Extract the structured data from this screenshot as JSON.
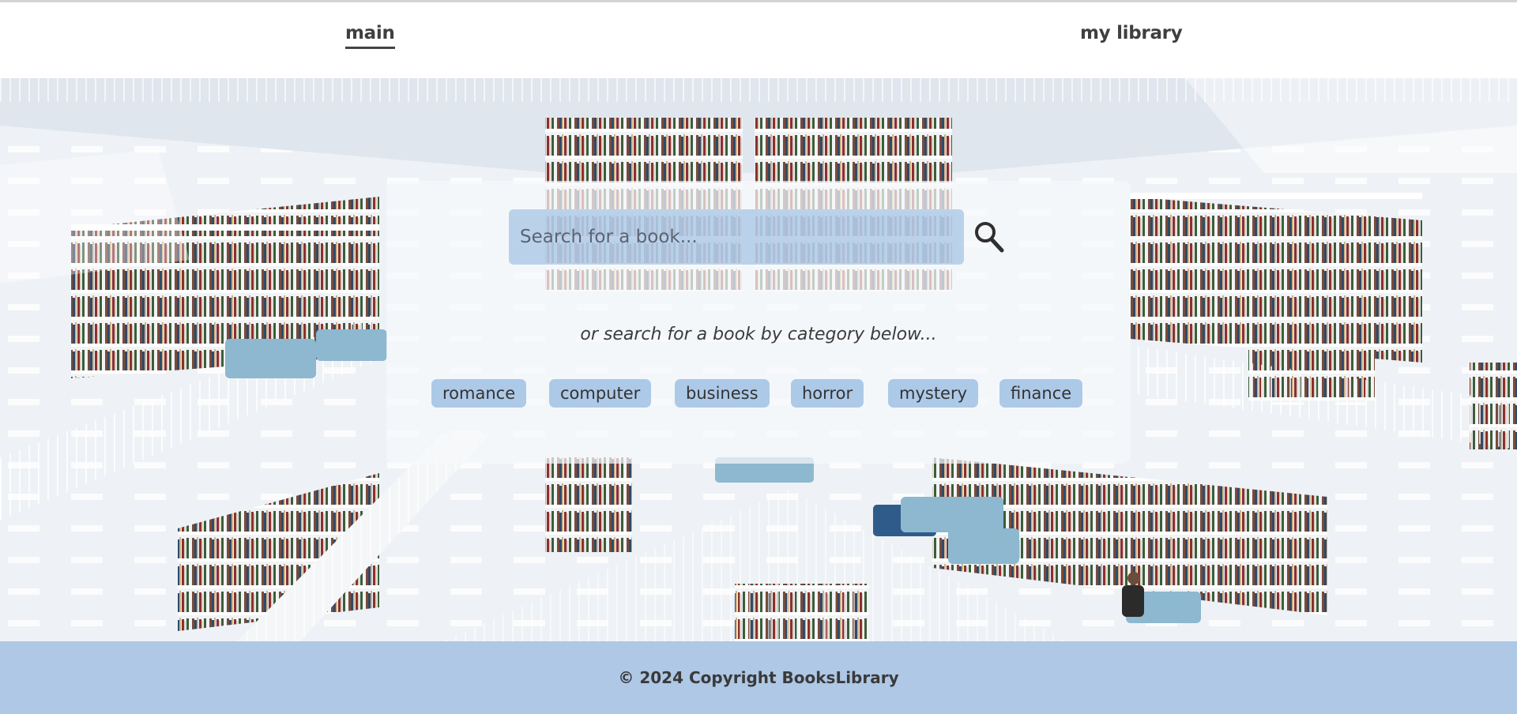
{
  "nav": {
    "main_label": "main",
    "library_label": "my library"
  },
  "search": {
    "placeholder": "Search for a book...",
    "button_icon": "search-icon"
  },
  "hint_text": "or search for a book by category below...",
  "categories": [
    "romance",
    "computer",
    "business",
    "horror",
    "mystery",
    "finance"
  ],
  "footer": {
    "copyright": "© 2024 Copyright BooksLibrary"
  },
  "colors": {
    "footer_bg": "#aec8e6",
    "accent_pill": "#96b9e1",
    "nav_text": "#3f3f3f"
  }
}
